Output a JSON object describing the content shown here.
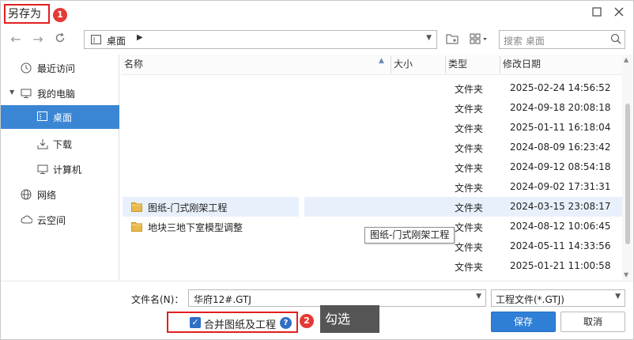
{
  "window": {
    "title": "另存为",
    "step1_badge": "1",
    "maximize_icon": "maximize-icon",
    "close_icon": "close-icon"
  },
  "toolbar": {
    "address_path": "桌面",
    "search_placeholder": "搜索 桌面"
  },
  "sidebar": {
    "items": [
      {
        "label": "最近访问",
        "icon": "clock-icon"
      },
      {
        "label": "我的电脑",
        "icon": "computer-icon"
      },
      {
        "label": "桌面",
        "icon": "desktop-icon",
        "active": true
      },
      {
        "label": "下载",
        "icon": "download-icon"
      },
      {
        "label": "计算机",
        "icon": "monitor-icon"
      },
      {
        "label": "网络",
        "icon": "globe-icon"
      },
      {
        "label": "云空间",
        "icon": "cloud-icon"
      }
    ]
  },
  "filelist": {
    "columns": {
      "name": "名称",
      "size": "大小",
      "type": "类型",
      "modified": "修改日期"
    },
    "rows": [
      {
        "name": "",
        "type": "文件夹",
        "modified": "2025-02-24 14:56:52"
      },
      {
        "name": "",
        "type": "文件夹",
        "modified": "2024-09-18 20:08:18"
      },
      {
        "name": "",
        "type": "文件夹",
        "modified": "2025-01-11 16:18:04"
      },
      {
        "name": "",
        "type": "文件夹",
        "modified": "2024-08-09 16:23:42"
      },
      {
        "name": "",
        "type": "文件夹",
        "modified": "2024-09-12 08:54:18"
      },
      {
        "name": "",
        "type": "文件夹",
        "modified": "2024-09-02 17:31:31"
      },
      {
        "name": "图纸-门式刚架工程",
        "type": "文件夹",
        "modified": "2024-03-15 23:08:17"
      },
      {
        "name": "地块三地下室模型调整",
        "type": "文件夹",
        "modified": "2024-08-12 10:06:45"
      },
      {
        "name": "",
        "type": "文件夹",
        "modified": "2024-05-11 14:33:56"
      },
      {
        "name": "",
        "type": "文件夹",
        "modified": "2025-01-21 11:00:58"
      }
    ],
    "tooltip": "图纸-门式刚架工程"
  },
  "bottom": {
    "filename_label": "文件名(N)：",
    "filename_value": "华府12#.GTJ",
    "filetype_value": "工程文件(*.GTJ)",
    "merge_label": "合并图纸及工程",
    "help_glyph": "?",
    "step2_badge": "2",
    "callout": "勾选",
    "save_label": "保存",
    "cancel_label": "取消"
  },
  "colors": {
    "accent": "#3a86d4",
    "annotation_red": "#e02020",
    "callout_bg": "#555555"
  }
}
